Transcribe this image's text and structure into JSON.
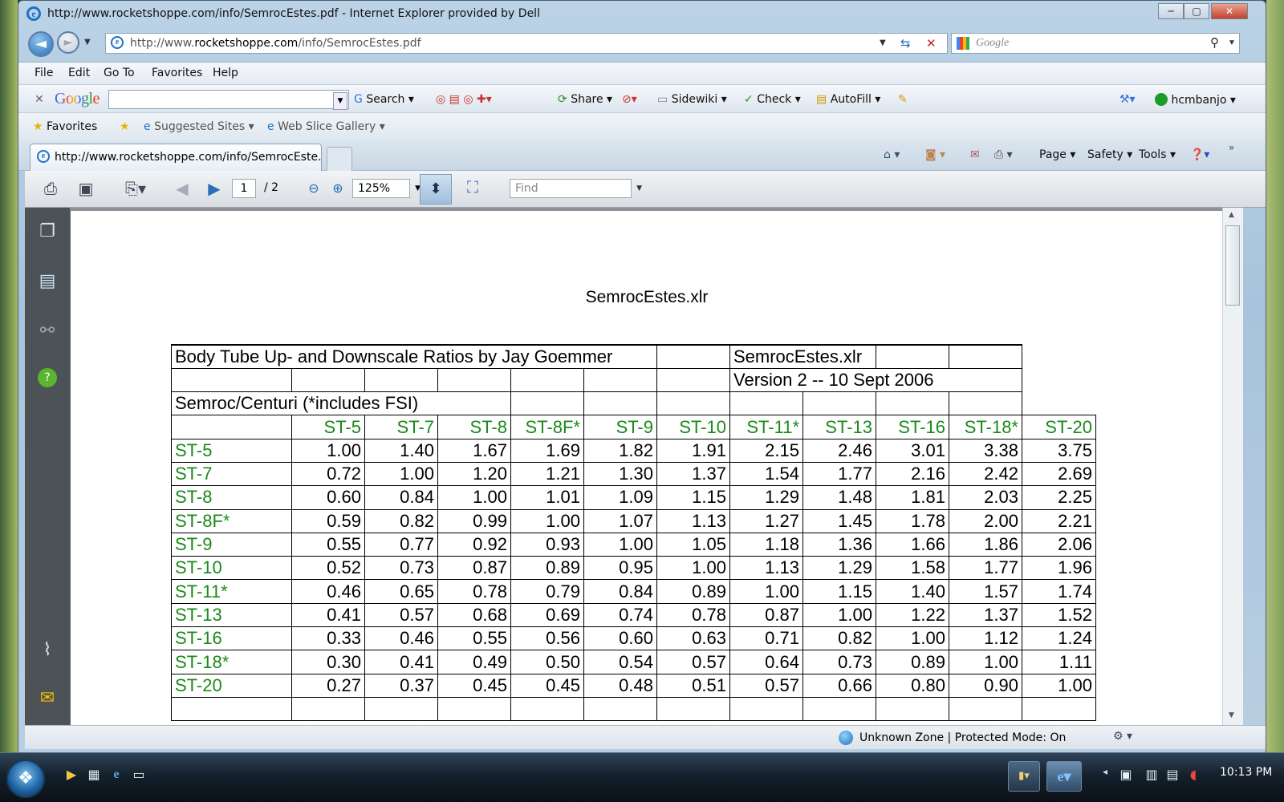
{
  "window": {
    "title": "http://www.rocketshoppe.com/info/SemrocEstes.pdf - Internet Explorer provided by Dell",
    "minimize": "─",
    "maximize": "▢",
    "close": "✕"
  },
  "navbar": {
    "back": "◄",
    "forward": "►",
    "address_prefix": "http://www.",
    "address_domain": "rocketshoppe.com",
    "address_path": "/info/SemrocEstes.pdf",
    "search_placeholder": "Google"
  },
  "menu": [
    "File",
    "Edit",
    "Go To",
    "Favorites",
    "Help"
  ],
  "google_toolbar": {
    "logo": "Google",
    "search": "Search",
    "share": "Share",
    "sidewiki": "Sidewiki",
    "check": "Check",
    "autofill": "AutoFill",
    "user": "hcmbanjo"
  },
  "favorites_bar": {
    "favorites": "Favorites",
    "suggested": "Suggested Sites",
    "webslice": "Web Slice Gallery"
  },
  "tab": {
    "label": "http://www.rocketshoppe.com/info/SemrocEste..."
  },
  "command_bar": {
    "page": "Page",
    "safety": "Safety",
    "tools": "Tools"
  },
  "pdf_toolbar": {
    "page_current": "1",
    "page_total": "/ 2",
    "zoom": "125%",
    "find_placeholder": "Find"
  },
  "status": {
    "zone": "Unknown Zone | Protected Mode: On"
  },
  "taskbar": {
    "clock": "10:13 PM"
  },
  "document": {
    "title": "SemrocEstes.xlr",
    "header_title": "Body Tube Up- and Downscale Ratios by Jay Goemmer",
    "file_label": "SemrocEstes.xlr",
    "version": "Version 2 -- 10 Sept 2006",
    "subtitle": "Semroc/Centuri (*includes FSI)",
    "columns": [
      "ST-5",
      "ST-7",
      "ST-8",
      "ST-8F*",
      "ST-9",
      "ST-10",
      "ST-11*",
      "ST-13",
      "ST-16",
      "ST-18*",
      "ST-20"
    ],
    "rows": [
      {
        "label": "ST-5",
        "values": [
          "1.00",
          "1.40",
          "1.67",
          "1.69",
          "1.82",
          "1.91",
          "2.15",
          "2.46",
          "3.01",
          "3.38",
          "3.75"
        ]
      },
      {
        "label": "ST-7",
        "values": [
          "0.72",
          "1.00",
          "1.20",
          "1.21",
          "1.30",
          "1.37",
          "1.54",
          "1.77",
          "2.16",
          "2.42",
          "2.69"
        ]
      },
      {
        "label": "ST-8",
        "values": [
          "0.60",
          "0.84",
          "1.00",
          "1.01",
          "1.09",
          "1.15",
          "1.29",
          "1.48",
          "1.81",
          "2.03",
          "2.25"
        ]
      },
      {
        "label": "ST-8F*",
        "values": [
          "0.59",
          "0.82",
          "0.99",
          "1.00",
          "1.07",
          "1.13",
          "1.27",
          "1.45",
          "1.78",
          "2.00",
          "2.21"
        ]
      },
      {
        "label": "ST-9",
        "values": [
          "0.55",
          "0.77",
          "0.92",
          "0.93",
          "1.00",
          "1.05",
          "1.18",
          "1.36",
          "1.66",
          "1.86",
          "2.06"
        ]
      },
      {
        "label": "ST-10",
        "values": [
          "0.52",
          "0.73",
          "0.87",
          "0.89",
          "0.95",
          "1.00",
          "1.13",
          "1.29",
          "1.58",
          "1.77",
          "1.96"
        ]
      },
      {
        "label": "ST-11*",
        "values": [
          "0.46",
          "0.65",
          "0.78",
          "0.79",
          "0.84",
          "0.89",
          "1.00",
          "1.15",
          "1.40",
          "1.57",
          "1.74"
        ]
      },
      {
        "label": "ST-13",
        "values": [
          "0.41",
          "0.57",
          "0.68",
          "0.69",
          "0.74",
          "0.78",
          "0.87",
          "1.00",
          "1.22",
          "1.37",
          "1.52"
        ]
      },
      {
        "label": "ST-16",
        "values": [
          "0.33",
          "0.46",
          "0.55",
          "0.56",
          "0.60",
          "0.63",
          "0.71",
          "0.82",
          "1.00",
          "1.12",
          "1.24"
        ]
      },
      {
        "label": "ST-18*",
        "values": [
          "0.30",
          "0.41",
          "0.49",
          "0.50",
          "0.54",
          "0.57",
          "0.64",
          "0.73",
          "0.89",
          "1.00",
          "1.11"
        ]
      },
      {
        "label": "ST-20",
        "values": [
          "0.27",
          "0.37",
          "0.45",
          "0.45",
          "0.48",
          "0.51",
          "0.57",
          "0.66",
          "0.80",
          "0.90",
          "1.00"
        ]
      }
    ]
  },
  "colors": {
    "label_green": "#1a8a1a",
    "pdf_sidebar": "#4d5257"
  }
}
